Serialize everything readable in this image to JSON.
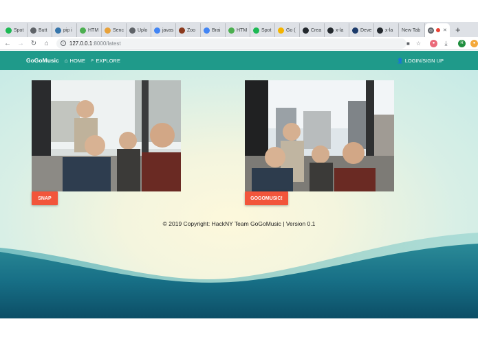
{
  "browser": {
    "tabs": [
      {
        "label": "Spot",
        "icon": "spotify-icon",
        "color": "#1db954"
      },
      {
        "label": "Butt",
        "icon": "globe-icon",
        "color": "#5f6368"
      },
      {
        "label": "pip i",
        "icon": "python-icon",
        "color": "#3776ab"
      },
      {
        "label": "HTM",
        "icon": "html-icon",
        "color": "#4caf50"
      },
      {
        "label": "Senc",
        "icon": "pen-icon",
        "color": "#e8a23a"
      },
      {
        "label": "Uplo",
        "icon": "code-icon",
        "color": "#5f6368"
      },
      {
        "label": "javas",
        "icon": "google-icon",
        "color": "#4285f4"
      },
      {
        "label": "Zoo",
        "icon": "star-icon",
        "color": "#8b3a1e"
      },
      {
        "label": "Brai",
        "icon": "doc-icon",
        "color": "#4285f4"
      },
      {
        "label": "HTM",
        "icon": "html-icon",
        "color": "#4caf50"
      },
      {
        "label": "Spot",
        "icon": "spotify-icon",
        "color": "#1db954"
      },
      {
        "label": "Go (",
        "icon": "folder-icon",
        "color": "#f4b400"
      },
      {
        "label": "Crea",
        "icon": "github-icon",
        "color": "#24292e"
      },
      {
        "label": "x-la",
        "icon": "github-icon",
        "color": "#24292e"
      },
      {
        "label": "Deve",
        "icon": "dev-icon",
        "color": "#1d3c6b"
      },
      {
        "label": "x-la",
        "icon": "github-icon",
        "color": "#24292e"
      },
      {
        "label": "New Tab",
        "icon": "",
        "color": ""
      }
    ],
    "address": {
      "host": "127.0.0.1",
      "path": ":8000/latest"
    },
    "profile_initial": "R"
  },
  "nav": {
    "brand": "GoGoMusic",
    "home": "HOME",
    "explore": "EXPLORE",
    "login": "LOGIN/SIGN UP"
  },
  "photos": [
    {
      "alt": "group selfie",
      "button": "SNAP"
    },
    {
      "alt": "group selfie",
      "button": "GOGOMUSIC!"
    }
  ],
  "footer": {
    "text": "© 2019 Copyright: HackNY Team GoGoMusic | Version 0.1"
  },
  "colors": {
    "navbar": "#1f9a8a",
    "button": "#f2553b",
    "wave_dark": "#115a72"
  }
}
